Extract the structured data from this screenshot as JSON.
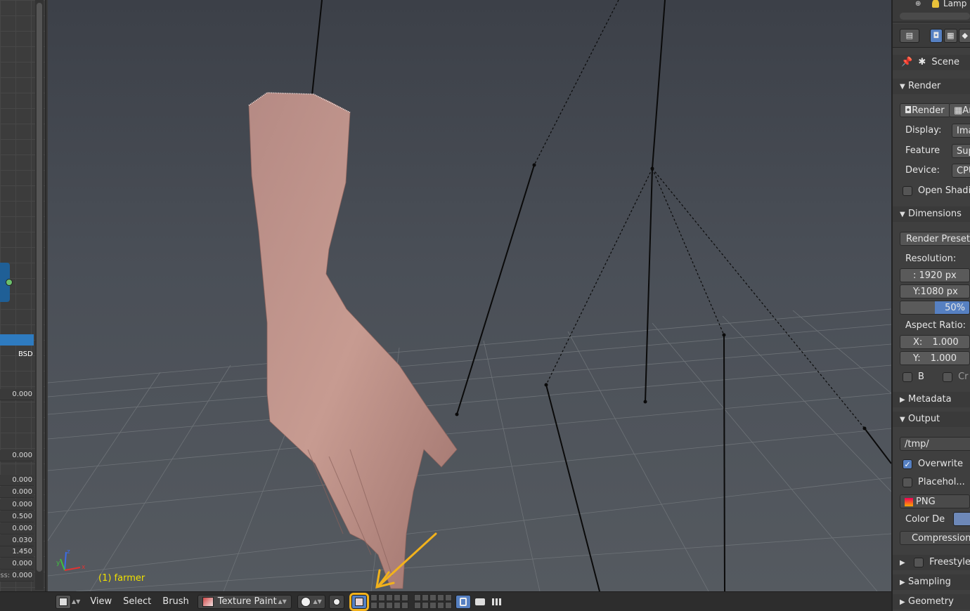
{
  "left_panel": {
    "node_label": "BSD",
    "values": [
      "0.000",
      "0.000",
      "0.000",
      "0.000",
      "0.000",
      "0.500",
      "0.000",
      "0.030",
      "1.450",
      "0.000",
      "0.000"
    ],
    "value_prefix": "ss:"
  },
  "viewport": {
    "object_label": "(1) farmer",
    "axes": {
      "x": "x",
      "y": "y",
      "z": "z"
    }
  },
  "viewport_header": {
    "view_menu": "View",
    "select_menu": "Select",
    "brush_menu": "Brush",
    "mode": "Texture Paint",
    "mode_icon": "texture-paint-icon",
    "arrows": "▲▼"
  },
  "properties": {
    "outliner_item": "Lamp",
    "scene_label": "Scene",
    "render_section": "Render",
    "render_button": "Render",
    "anim_button": "An",
    "display_label": "Display:",
    "display_value": "Ima",
    "feature_label": "Feature",
    "feature_value": "Sup",
    "device_label": "Device:",
    "device_value": "CPU",
    "open_shading": "Open Shadin",
    "dimensions_section": "Dimensions",
    "render_presets": "Render Presets",
    "resolution_label": "Resolution:",
    "res_x": ": 1920 px",
    "res_y": "Y:1080 px",
    "res_percent": "50%",
    "aspect_label": "Aspect Ratio:",
    "aspect_x_label": "X:",
    "aspect_x": "1.000",
    "aspect_y_label": "Y:",
    "aspect_y": "1.000",
    "border_label": "B",
    "crop_label": "Cr",
    "metadata_section": "Metadata",
    "output_section": "Output",
    "output_path": "/tmp/",
    "overwrite": "Overwrite",
    "placeholders": "Placehol...",
    "format": "PNG",
    "color_depth_label": "Color De",
    "compression": "Compression:",
    "freestyle_section": "Freestyle",
    "sampling_section": "Sampling",
    "geometry_section": "Geometry",
    "accent_color": "#5680c2"
  }
}
